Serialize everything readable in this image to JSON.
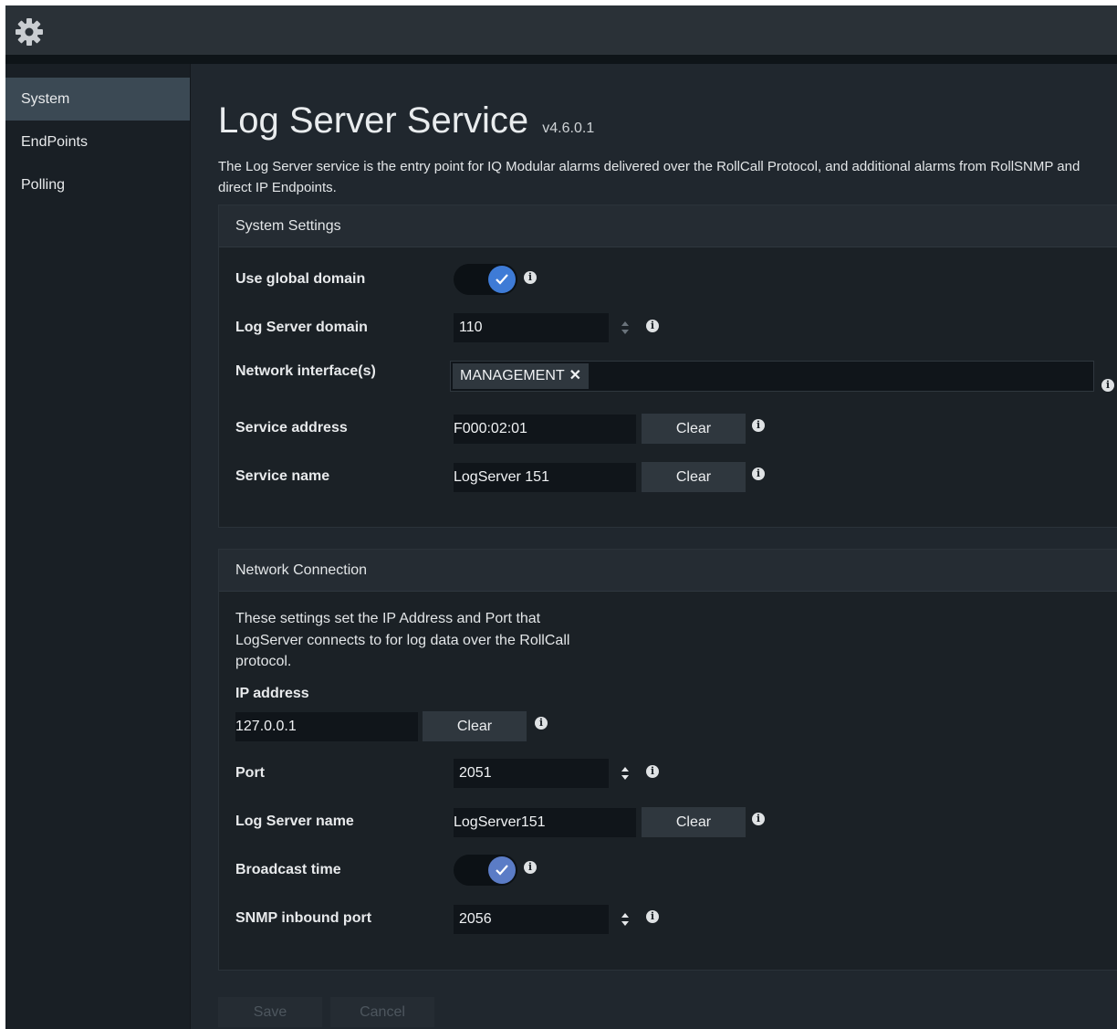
{
  "header": {
    "icon": "gear-icon"
  },
  "sidebar": {
    "items": [
      {
        "label": "System",
        "active": true
      },
      {
        "label": "EndPoints",
        "active": false
      },
      {
        "label": "Polling",
        "active": false
      }
    ]
  },
  "page": {
    "title": "Log Server Service",
    "version": "v4.6.0.1",
    "description": "The Log Server service is the entry point for IQ Modular alarms delivered over the RollCall Protocol, and additional alarms from RollSNMP and direct IP Endpoints."
  },
  "system_settings": {
    "heading": "System Settings",
    "use_global_domain": {
      "label": "Use global domain",
      "checked": true
    },
    "log_server_domain": {
      "label": "Log Server domain",
      "value": "110"
    },
    "network_interfaces": {
      "label": "Network interface(s)",
      "tag": "MANAGEMENT",
      "remove_glyph": "✕"
    },
    "service_address": {
      "label": "Service address",
      "value": "F000:02:01",
      "clear_label": "Clear"
    },
    "service_name": {
      "label": "Service name",
      "value": "LogServer 151",
      "clear_label": "Clear"
    }
  },
  "network_connection": {
    "heading": "Network Connection",
    "intro": "These settings set the IP Address and Port that LogServer connects to for log data over the RollCall protocol.",
    "ip_address": {
      "label": "IP address",
      "value": "127.0.0.1",
      "clear_label": "Clear"
    },
    "port": {
      "label": "Port",
      "value": "2051"
    },
    "log_server_name": {
      "label": "Log Server name",
      "value": "LogServer151",
      "clear_label": "Clear"
    },
    "broadcast_time": {
      "label": "Broadcast time",
      "checked": true
    },
    "snmp_inbound_port": {
      "label": "SNMP inbound port",
      "value": "2056"
    }
  },
  "footer": {
    "save_label": "Save",
    "cancel_label": "Cancel"
  },
  "info_glyph": "i",
  "colors": {
    "accent": "#3e7bd6",
    "background": "#20272e",
    "sidebar_active": "#3b4954"
  }
}
